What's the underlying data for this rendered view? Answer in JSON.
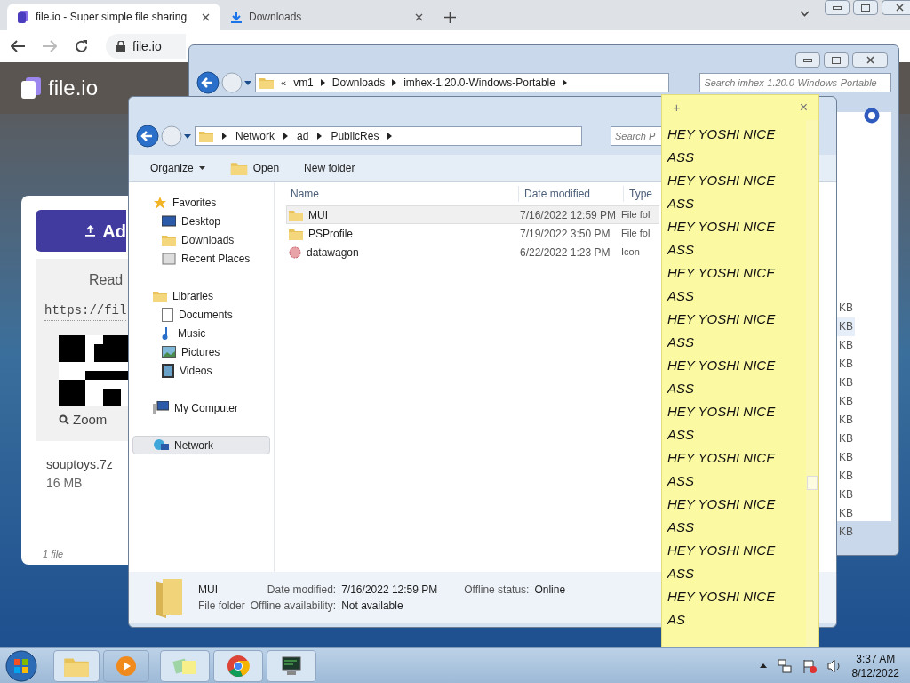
{
  "browser": {
    "tabs": [
      {
        "title": "file.io - Super simple file sharing",
        "selected": true
      },
      {
        "title": "Downloads",
        "selected": false
      }
    ],
    "url": "file.io",
    "page": {
      "logo": "file.io",
      "add_button": "Ad",
      "ready_text": "Read",
      "link": "https://fil",
      "zoom": "Zoom",
      "file_name": "souptoys.7z",
      "file_size": "16 MB",
      "file_count": "1 file"
    }
  },
  "back_explorer": {
    "path": [
      "vm1",
      "Downloads",
      "imhex-1.20.0-Windows-Portable"
    ],
    "search": {
      "placeholder": "Search imhex-1.20.0-Windows-Portable"
    },
    "overflow": "«",
    "sizes": [
      {
        "text": "KB",
        "selected": false
      },
      {
        "text": "KB",
        "selected": true
      },
      {
        "text": "KB",
        "selected": false
      },
      {
        "text": "KB",
        "selected": false
      },
      {
        "text": "KB",
        "selected": false
      },
      {
        "text": "KB",
        "selected": false
      },
      {
        "text": "KB",
        "selected": false
      },
      {
        "text": "KB",
        "selected": false
      },
      {
        "text": "KB",
        "selected": false
      },
      {
        "text": "KB",
        "selected": false
      },
      {
        "text": "KB",
        "selected": false
      },
      {
        "text": "KB",
        "selected": false
      },
      {
        "text": "KB",
        "selected": false
      }
    ]
  },
  "explorer": {
    "path": [
      "Network",
      "ad",
      "PublicRes"
    ],
    "search": {
      "placeholder": "Search P"
    },
    "toolbar": [
      "Organize",
      "Open",
      "New folder"
    ],
    "sidebar": [
      {
        "label": "Favorites",
        "kind": "star",
        "selected": false,
        "children": [
          {
            "label": "Desktop",
            "kind": "desktop",
            "selected": false
          },
          {
            "label": "Downloads",
            "kind": "downloads",
            "selected": false
          },
          {
            "label": "Recent Places",
            "kind": "recent",
            "selected": false
          }
        ]
      },
      {
        "label": "Libraries",
        "kind": "library",
        "selected": false,
        "children": [
          {
            "label": "Documents",
            "kind": "document",
            "selected": false
          },
          {
            "label": "Music",
            "kind": "music",
            "selected": false
          },
          {
            "label": "Pictures",
            "kind": "picture",
            "selected": false
          },
          {
            "label": "Videos",
            "kind": "video",
            "selected": false
          }
        ]
      },
      {
        "label": "My Computer",
        "kind": "computer",
        "selected": false
      },
      {
        "label": "Network",
        "kind": "network",
        "selected": true
      }
    ],
    "columns": [
      "Name",
      "Date modified",
      "Type"
    ],
    "rows": [
      {
        "name": "MUI",
        "date": "7/16/2022 12:59 PM",
        "type": "File fol",
        "kind": "folder",
        "selected": true
      },
      {
        "name": "PSProfile",
        "date": "7/19/2022 3:50 PM",
        "type": "File fol",
        "kind": "folder",
        "selected": false
      },
      {
        "name": "datawagon",
        "date": "6/22/2022 1:23 PM",
        "type": "Icon",
        "kind": "icon",
        "selected": false
      }
    ],
    "details": {
      "name": "MUI",
      "type": "File folder",
      "date_label": "Date modified:",
      "date": "7/16/2022 12:59 PM",
      "status_label": "Offline status:",
      "status": "Online",
      "avail_label": "Offline availability:",
      "avail": "Not available"
    }
  },
  "sticky_note": {
    "add": "+",
    "close": "×",
    "lines": [
      "HEY YOSHI NICE",
      "ASS",
      "HEY YOSHI NICE",
      "ASS",
      "HEY YOSHI NICE",
      "ASS",
      "HEY YOSHI NICE",
      "ASS",
      "HEY YOSHI NICE",
      "ASS",
      "HEY YOSHI NICE",
      "ASS",
      "HEY YOSHI NICE",
      "ASS",
      "HEY YOSHI NICE",
      "ASS",
      "HEY YOSHI NICE",
      "ASS",
      "HEY YOSHI NICE",
      "ASS",
      "HEY YOSHI NICE",
      "AS"
    ]
  },
  "taskbar": {
    "time": "3:37 AM",
    "date": "8/12/2022"
  }
}
